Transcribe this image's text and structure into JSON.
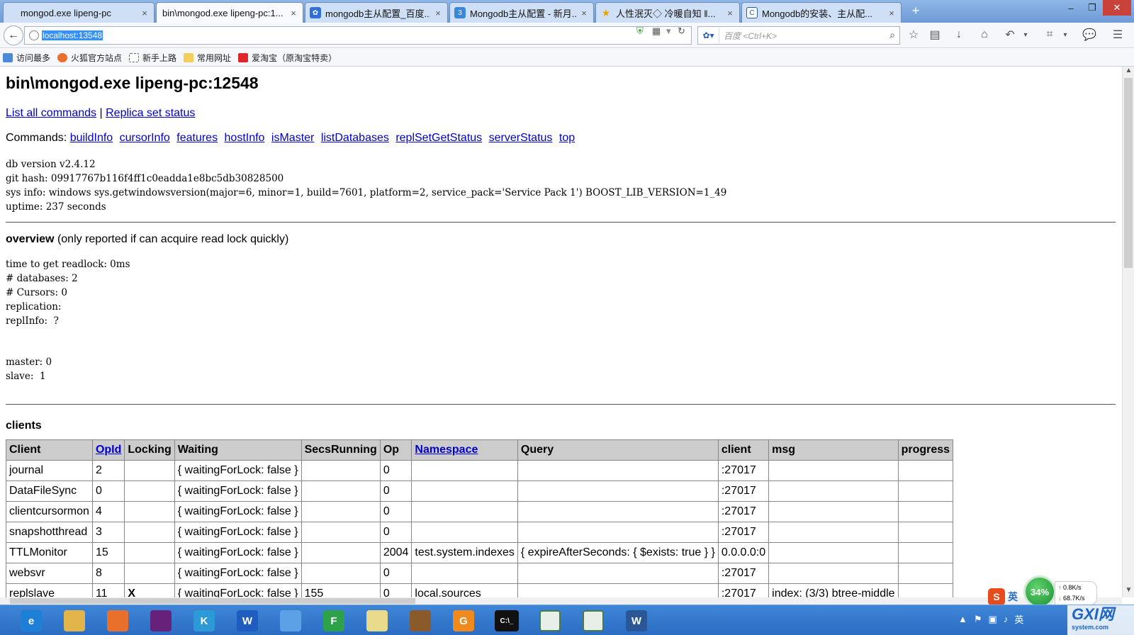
{
  "window": {
    "minimize": "–",
    "restore": "❐",
    "close": "✕"
  },
  "tabs": [
    {
      "title": "mongod.exe lipeng-pc",
      "close": "×",
      "icon": "page-icon"
    },
    {
      "title": "bin\\mongod.exe lipeng-pc:1...",
      "close": "×",
      "icon": "page-icon"
    },
    {
      "title": "mongodb主从配置_百度...",
      "close": "×",
      "icon": "baidu-paw-icon"
    },
    {
      "title": "Mongodb主从配置 - 新月...",
      "close": "×",
      "icon": "blog-icon"
    },
    {
      "title": "人性泯灭◇ 冷暖自知 ‖...",
      "close": "×",
      "icon": "star-icon"
    },
    {
      "title": "Mongodb的安装、主从配...",
      "close": "×",
      "icon": "site-c-icon"
    }
  ],
  "new_tab_label": "+",
  "navbar": {
    "url": "localhost:13548",
    "search_placeholder": "百度 <Ctrl+K>"
  },
  "bookmarks": [
    {
      "label": "访问最多",
      "icon": "chart-icon"
    },
    {
      "label": "火狐官方站点",
      "icon": "firefox-icon"
    },
    {
      "label": "新手上路",
      "icon": "page-icon"
    },
    {
      "label": "常用网址",
      "icon": "folder-icon"
    },
    {
      "label": "爱淘宝（原淘宝特卖）",
      "icon": "taobao-icon"
    }
  ],
  "page": {
    "title": "bin\\mongod.exe lipeng-pc:12548",
    "top_links": {
      "list_all_commands": "List all commands",
      "separator": "|",
      "replica_set_status": "Replica set status"
    },
    "commands_label": "Commands:",
    "commands": [
      "buildInfo",
      "cursorInfo",
      "features",
      "hostInfo",
      "isMaster",
      "listDatabases",
      "replSetGetStatus",
      "serverStatus",
      "top"
    ],
    "version_lines": [
      "db version v2.4.12",
      "git hash: 09917767b116f4ff1c0eadda1e8bc5db30828500",
      "sys info: windows sys.getwindowsversion(major=6, minor=1, build=7601, platform=2, service_pack='Service Pack 1') BOOST_LIB_VERSION=1_49",
      "uptime: 237 seconds"
    ],
    "overview_bold": "overview",
    "overview_note": "(only reported if can acquire read lock quickly)",
    "overview_lines": [
      "time to get readlock: 0ms",
      "# databases: 2",
      "# Cursors: 0",
      "replication:",
      "replInfo:  ?"
    ],
    "master_lines": [
      "master: 0",
      "slave:  1"
    ],
    "clients_heading": "clients",
    "clients_table": {
      "headers": [
        "Client",
        "OpId",
        "Locking",
        "Waiting",
        "SecsRunning",
        "Op",
        "Namespace",
        "Query",
        "client",
        "msg",
        "progress"
      ],
      "rows": [
        [
          "journal",
          "2",
          "",
          "{ waitingForLock: false }",
          "",
          "0",
          "",
          "",
          ":27017",
          "",
          ""
        ],
        [
          "DataFileSync",
          "0",
          "",
          "{ waitingForLock: false }",
          "",
          "0",
          "",
          "",
          ":27017",
          "",
          ""
        ],
        [
          "clientcursormon",
          "4",
          "",
          "{ waitingForLock: false }",
          "",
          "0",
          "",
          "",
          ":27017",
          "",
          ""
        ],
        [
          "snapshotthread",
          "3",
          "",
          "{ waitingForLock: false }",
          "",
          "0",
          "",
          "",
          ":27017",
          "",
          ""
        ],
        [
          "TTLMonitor",
          "15",
          "",
          "{ waitingForLock: false }",
          "",
          "2004",
          "test.system.indexes",
          "{ expireAfterSeconds: { $exists: true } }",
          "0.0.0.0:0",
          "",
          ""
        ],
        [
          "websvr",
          "8",
          "",
          "{ waitingForLock: false }",
          "",
          "0",
          "",
          "",
          ":27017",
          "",
          ""
        ],
        [
          "replslave",
          "11",
          "X",
          "{ waitingForLock: false }",
          "155",
          "0",
          "local.sources",
          "",
          ":27017",
          "index: (3/3) btree-middle",
          ""
        ]
      ]
    }
  },
  "overlay": {
    "speed_percent": "34%",
    "upload": "0.8K/s",
    "download": "68.7K/s",
    "ime_logo": "S",
    "ime_lang": "英"
  },
  "taskbar": {
    "apps": [
      {
        "name": "internet-explorer-icon",
        "glyph": "e",
        "color": "#1e7fd6"
      },
      {
        "name": "file-explorer-icon",
        "glyph": "",
        "color": "#e2b54a"
      },
      {
        "name": "firefox-icon",
        "glyph": "",
        "color": "#e8702a"
      },
      {
        "name": "visual-studio-icon",
        "glyph": "",
        "color": "#68217a"
      },
      {
        "name": "k-app-icon",
        "glyph": "K",
        "color": "#2d9ad8"
      },
      {
        "name": "wps-writer-icon",
        "glyph": "W",
        "color": "#1f5cbf"
      },
      {
        "name": "tools-icon",
        "glyph": "",
        "color": "#5ca0e6"
      },
      {
        "name": "feiq-icon",
        "glyph": "F",
        "color": "#2ea24a"
      },
      {
        "name": "folder-icon",
        "glyph": "",
        "color": "#e9d98a"
      },
      {
        "name": "user-photo-icon",
        "glyph": "",
        "color": "#8a5a2a"
      },
      {
        "name": "pdf-reader-icon",
        "glyph": "G",
        "color": "#f08a1c"
      },
      {
        "name": "command-prompt-icon",
        "glyph": "C:\\_",
        "color": "#111111"
      },
      {
        "name": "document-window-icon",
        "glyph": "",
        "color": "#e8efe8"
      },
      {
        "name": "document-window-icon-2",
        "glyph": "",
        "color": "#e8efe8"
      },
      {
        "name": "word-icon",
        "glyph": "W",
        "color": "#2b5797"
      }
    ],
    "tray_lang": "英"
  },
  "watermark": {
    "main": "GXI网",
    "sub": "system.com"
  },
  "colors": {
    "link": "#0000cc",
    "table_header_bg": "#cccccc",
    "url_highlight": "#3390ff",
    "taskbar": "#2a6cc2"
  }
}
